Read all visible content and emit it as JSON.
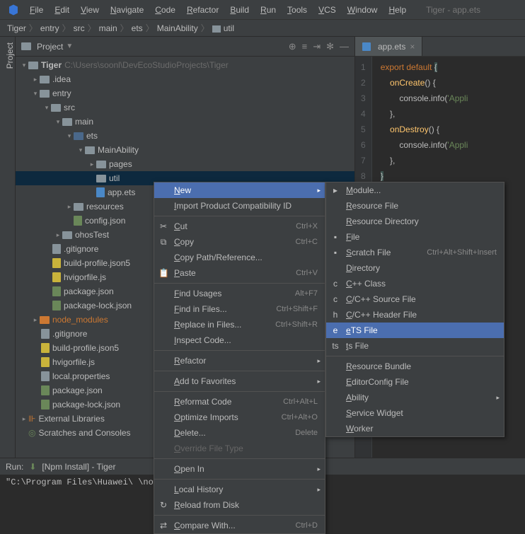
{
  "app_title": "Tiger - app.ets",
  "menubar": [
    "File",
    "Edit",
    "View",
    "Navigate",
    "Code",
    "Refactor",
    "Build",
    "Run",
    "Tools",
    "VCS",
    "Window",
    "Help"
  ],
  "breadcrumb": [
    "Tiger",
    "entry",
    "src",
    "main",
    "ets",
    "MainAbility",
    "util"
  ],
  "panel": {
    "title": "Project"
  },
  "tree": {
    "root": "Tiger",
    "root_path": "C:\\Users\\soonl\\DevEcoStudioProjects\\Tiger",
    "idea": ".idea",
    "entry": "entry",
    "src": "src",
    "main_dir": "main",
    "ets": "ets",
    "mainability": "MainAbility",
    "pages": "pages",
    "util": "util",
    "app_ets": "app.ets",
    "resources": "resources",
    "config_json": "config.json",
    "ohostest": "ohosTest",
    "gitignore1": ".gitignore",
    "build_profile1": "build-profile.json5",
    "hvigorfile1": "hvigorfile.js",
    "package1": "package.json",
    "package_lock1": "package-lock.json",
    "node_modules": "node_modules",
    "gitignore2": ".gitignore",
    "build_profile2": "build-profile.json5",
    "hvigorfile2": "hvigorfile.js",
    "local_props": "local.properties",
    "package2": "package.json",
    "package_lock2": "package-lock.json",
    "ext_libs": "External Libraries",
    "scratches": "Scratches and Consoles"
  },
  "tab": {
    "name": "app.ets"
  },
  "code": {
    "l1": "export default {",
    "l2": "    onCreate() {",
    "l3a": "        console.info(",
    "l3b": "'Appli",
    "l4": "    },",
    "l5": "    onDestroy() {",
    "l6a": "        console.info(",
    "l6b": "'Appli",
    "l7": "    },",
    "l8": "}"
  },
  "cm1": [
    {
      "label": "New",
      "sub": true,
      "hl": true
    },
    {
      "label": "Import Product Compatibility ID"
    },
    {
      "sep": true
    },
    {
      "label": "Cut",
      "sc": "Ctrl+X",
      "icon": "✂"
    },
    {
      "label": "Copy",
      "sc": "Ctrl+C",
      "icon": "⧉"
    },
    {
      "label": "Copy Path/Reference..."
    },
    {
      "label": "Paste",
      "sc": "Ctrl+V",
      "icon": "📋"
    },
    {
      "sep": true
    },
    {
      "label": "Find Usages",
      "sc": "Alt+F7"
    },
    {
      "label": "Find in Files...",
      "sc": "Ctrl+Shift+F"
    },
    {
      "label": "Replace in Files...",
      "sc": "Ctrl+Shift+R"
    },
    {
      "label": "Inspect Code..."
    },
    {
      "sep": true
    },
    {
      "label": "Refactor",
      "sub": true
    },
    {
      "sep": true
    },
    {
      "label": "Add to Favorites",
      "sub": true
    },
    {
      "sep": true
    },
    {
      "label": "Reformat Code",
      "sc": "Ctrl+Alt+L"
    },
    {
      "label": "Optimize Imports",
      "sc": "Ctrl+Alt+O"
    },
    {
      "label": "Delete...",
      "sc": "Delete"
    },
    {
      "label": "Override File Type",
      "disabled": true
    },
    {
      "sep": true
    },
    {
      "label": "Open In",
      "sub": true
    },
    {
      "sep": true
    },
    {
      "label": "Local History",
      "sub": true
    },
    {
      "label": "Reload from Disk",
      "icon": "↻"
    },
    {
      "sep": true
    },
    {
      "label": "Compare With...",
      "sc": "Ctrl+D",
      "icon": "⇄"
    }
  ],
  "cm2": [
    {
      "label": "Module...",
      "icon": "▸"
    },
    {
      "label": "Resource File"
    },
    {
      "label": "Resource Directory"
    },
    {
      "label": "File",
      "icon": "▪"
    },
    {
      "label": "Scratch File",
      "sc": "Ctrl+Alt+Shift+Insert",
      "icon": "▪"
    },
    {
      "label": "Directory"
    },
    {
      "label": "C++ Class",
      "icon": "c"
    },
    {
      "label": "C/C++ Source File",
      "icon": "c"
    },
    {
      "label": "C/C++ Header File",
      "icon": "h"
    },
    {
      "label": "eTS File",
      "icon": "e",
      "hl": true
    },
    {
      "label": "ts File",
      "icon": "ts"
    },
    {
      "sep": true
    },
    {
      "label": "Resource Bundle"
    },
    {
      "label": "EditorConfig File"
    },
    {
      "label": "Ability",
      "sub": true
    },
    {
      "label": "Service Widget"
    },
    {
      "label": "Worker"
    }
  ],
  "run": {
    "label": "Run:",
    "task": "[Npm Install] - Tiger"
  },
  "terminal": "\"C:\\Program Files\\Huawei\\                              \\nodejs\\npm.cmd\" install --fetch-ret"
}
